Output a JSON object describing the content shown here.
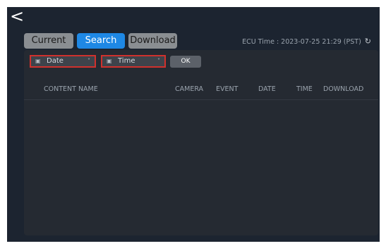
{
  "nav": {
    "back_icon": "chevron-left-icon",
    "back_glyph": "<"
  },
  "tabs": [
    {
      "label": "Current"
    },
    {
      "label": "Search",
      "active": true
    },
    {
      "label": "Download"
    }
  ],
  "ecu": {
    "text": "ECU Time : 2023-07-25 21:29 (PST)",
    "refresh_icon": "refresh-icon"
  },
  "filters": {
    "date_label": "Date",
    "time_label": "Time",
    "ok_label": "OK",
    "calendar_icon": "calendar-icon",
    "caret_icon": "caret-down-icon"
  },
  "table": {
    "columns": [
      "CONTENT NAME",
      "CAMERA",
      "EVENT",
      "DATE",
      "TIME",
      "DOWNLOAD"
    ]
  },
  "colors": {
    "background": "#1c2430",
    "panel": "#252a32",
    "accent": "#1e88e5",
    "tab_inactive": "#8a8e92",
    "highlight_border": "#d0312d"
  }
}
